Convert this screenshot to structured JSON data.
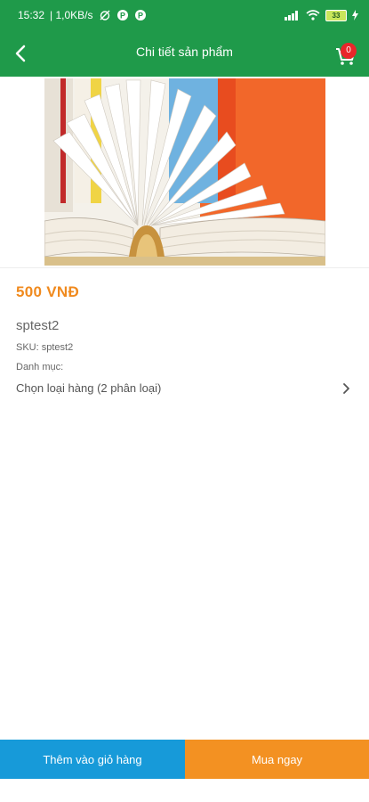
{
  "status_bar": {
    "time": "15:32",
    "network_speed": "| 1,0KB/s",
    "battery": "33",
    "icons": [
      "alarm-off-icon",
      "app-notification-icon",
      "app-notification-icon",
      "signal-icon",
      "wifi-icon",
      "battery-icon",
      "charging-icon"
    ]
  },
  "app_bar": {
    "title": "Chi tiết sản phẩm",
    "back_icon": "chevron-left-icon",
    "cart_icon": "cart-icon",
    "cart_count": "0"
  },
  "product": {
    "image_alt": "open book",
    "price": "500 VNĐ",
    "name": "sptest2",
    "sku": "SKU: sptest2",
    "category": "Danh mục:",
    "variant_label": "Chọn loại hàng (2 phân loại)"
  },
  "actions": {
    "add_to_cart": "Thêm vào giỏ hàng",
    "buy_now": "Mua ngay"
  },
  "colors": {
    "header": "#1f9a4a",
    "price": "#f08a1e",
    "add_to_cart": "#179ad9",
    "buy_now": "#f39122",
    "badge": "#e8262a"
  }
}
